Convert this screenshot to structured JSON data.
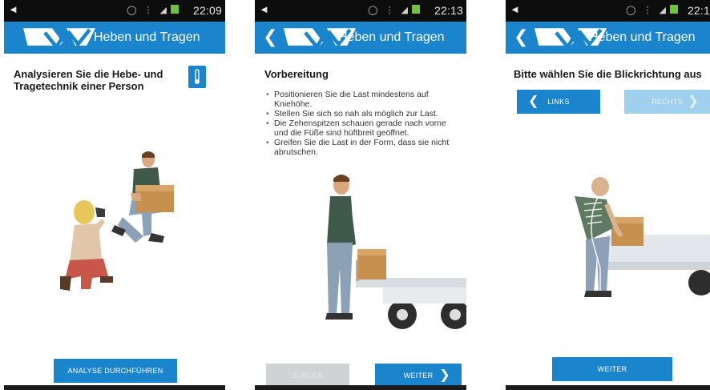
{
  "app": {
    "title": "Heben und Tragen"
  },
  "screens": [
    {
      "status_time": "22:09",
      "heading": "Analysieren Sie die Hebe- und Tragetechnik einer Person",
      "primary_button": "ANALYSE DURCHFÜHREN",
      "icons": {
        "info": "thermometer-info-icon",
        "logo": "avv-logo-icon"
      }
    },
    {
      "status_time": "22:13",
      "heading": "Vorbereitung",
      "bullets": [
        "Positionieren Sie die Last mindestens auf Kniehöhe.",
        "Stellen Sie sich so nah als möglich zur Last.",
        "Die Zehenspitzen schauen gerade nach vorne und die Füße sind hüftbreit geöffnet.",
        "Greifen Sie die Last in der Form, dass sie nicht abrutschen."
      ],
      "back_button": "ZURÜCK",
      "next_button": "WEITER"
    },
    {
      "status_time": "22:1",
      "heading": "Bitte wählen Sie die Blickrichtung aus",
      "left_button": "LINKS",
      "right_button": "RECHTS",
      "next_button": "WEITER"
    }
  ],
  "colors": {
    "accent": "#1a84cc",
    "status_bar": "#0d0d0d",
    "battery": "#6ec23f"
  }
}
